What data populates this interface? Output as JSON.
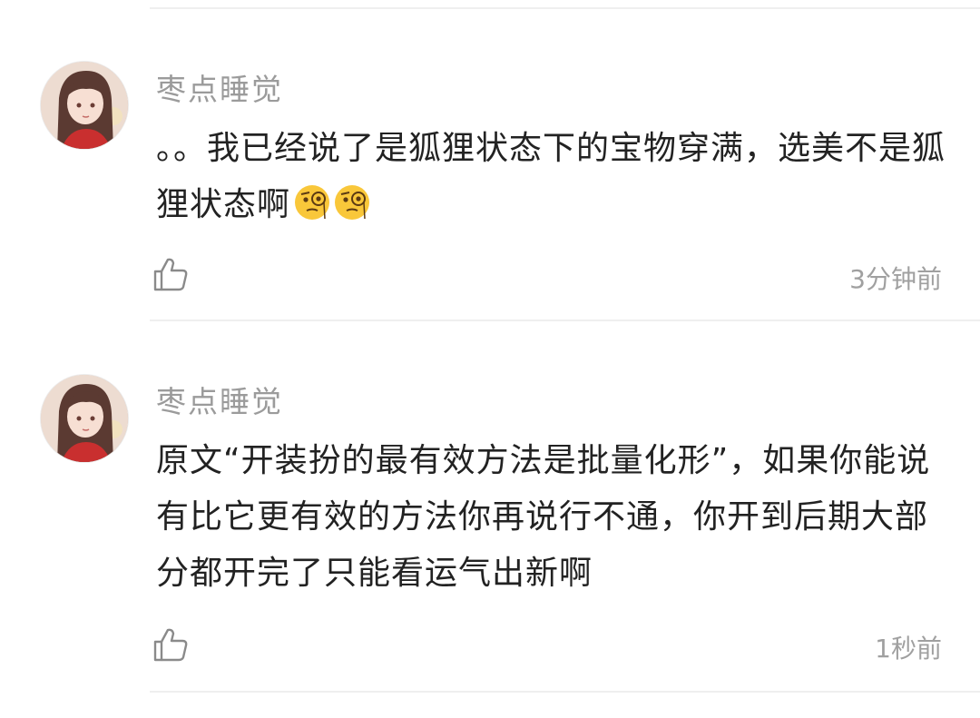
{
  "comments": [
    {
      "username": "枣点睡觉",
      "text": "。。我已经说了是狐狸状态下的宝物穿满，选美不是狐狸状态啊",
      "emojis": [
        "monocle-face-emoji",
        "monocle-face-emoji"
      ],
      "time": "3分钟前",
      "like_icon": "thumbs-up-icon"
    },
    {
      "username": "枣点睡觉",
      "text": "原文“开装扮的最有效方法是批量化形”，如果你能说有比它更有效的方法你再说行不通，你开到后期大部分都开完了只能看运气出新啊",
      "time": "1秒前",
      "like_icon": "thumbs-up-icon"
    }
  ],
  "colors": {
    "username": "#9b9b9b",
    "text": "#222222",
    "time": "#a0a0a0",
    "divider": "#efefef",
    "icon": "#8a8a8a"
  }
}
